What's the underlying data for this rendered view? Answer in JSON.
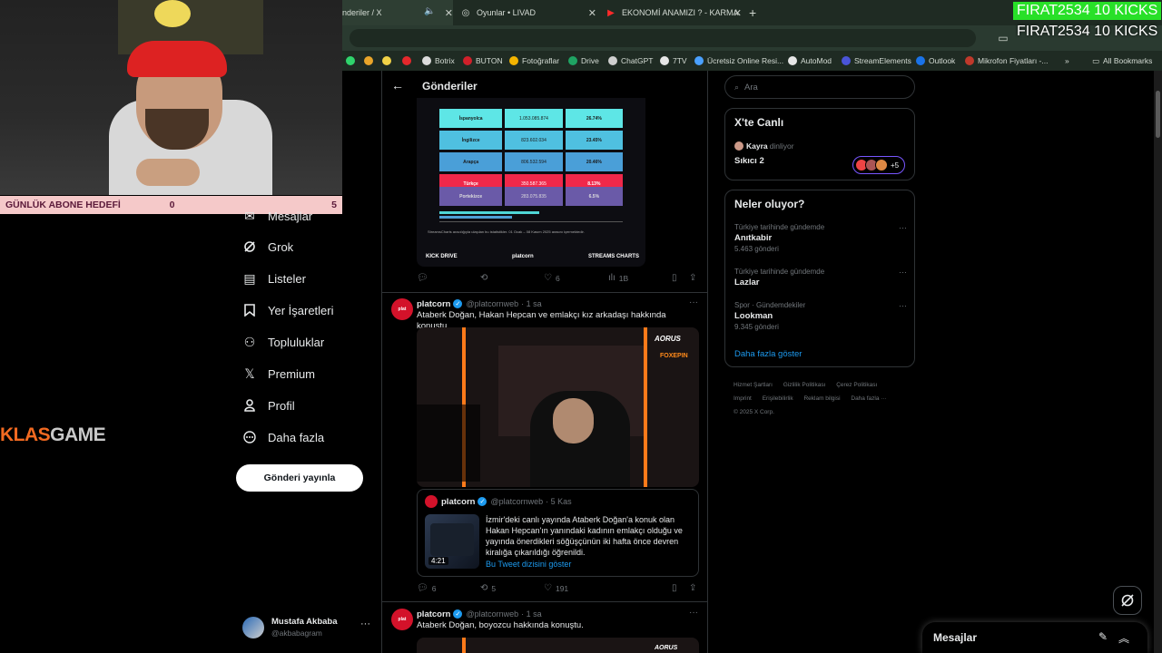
{
  "browser": {
    "tabs": [
      {
        "label": "nderiler / X",
        "icon": "x-logo-icon",
        "active": true
      },
      {
        "label": "Oyunlar • LIVAD",
        "icon": "globe-icon",
        "active": false
      },
      {
        "label": "EKONOMİ ANAMIZI ? - KARMA",
        "icon": "youtube-icon",
        "active": false
      }
    ],
    "bookmarks": [
      {
        "label": "Botrix"
      },
      {
        "label": "BUTON"
      },
      {
        "label": "Fotoğraflar"
      },
      {
        "label": "Drive"
      },
      {
        "label": "ChatGPT"
      },
      {
        "label": "7TV"
      },
      {
        "label": "Ücretsiz Online Resi..."
      },
      {
        "label": "AutoMod"
      },
      {
        "label": "StreamElements"
      },
      {
        "label": "Outlook"
      },
      {
        "label": "Mikrofon Fiyatları -..."
      },
      {
        "label": "All Bookmarks"
      }
    ]
  },
  "overlay": {
    "sub_goal_label": "GÜNLÜK ABONE HEDEFİ",
    "sub_goal_current": "0",
    "sub_goal_target": "5",
    "sponsor_part1": "KLAS",
    "sponsor_part2": "GAME",
    "kicks": "FIRAT2534  10 KICKS"
  },
  "nav": {
    "items": [
      {
        "label": "Mesajlar",
        "icon": "mail-icon"
      },
      {
        "label": "Grok",
        "icon": "grok-icon"
      },
      {
        "label": "Listeler",
        "icon": "list-icon"
      },
      {
        "label": "Yer İşaretleri",
        "icon": "bookmark-icon"
      },
      {
        "label": "Topluluklar",
        "icon": "communities-icon"
      },
      {
        "label": "Premium",
        "icon": "x-logo-icon"
      },
      {
        "label": "Profil",
        "icon": "profile-icon"
      },
      {
        "label": "Daha fazla",
        "icon": "more-circle-icon"
      }
    ],
    "post_button": "Gönderi yayınla",
    "account_name": "Mustafa Akbaba",
    "account_handle": "@akbabagram"
  },
  "main": {
    "title": "Gönderiler",
    "stats_table": [
      {
        "lang": "İspanyolca",
        "hours": "1.053.085.874",
        "share": "26.74%",
        "color": "#5ee6e6"
      },
      {
        "lang": "İngilizce",
        "hours": "823.602.034",
        "share": "23.45%",
        "color": "#4fc0e0"
      },
      {
        "lang": "Arapça",
        "hours": "806.532.594",
        "share": "20.46%",
        "color": "#4a9fd8"
      },
      {
        "lang": "Türkçe",
        "hours": "350.587.365",
        "share": "8.13%",
        "color": "#f0284a"
      },
      {
        "lang": "Portekizce",
        "hours": "283.075.835",
        "share": "6.5%",
        "color": "#6a5aa8"
      }
    ],
    "stats_footer": "StreamsCharts aracılığıyla ulaşılan bu istatistikler. 01 Ocak – 08 Kasım 2025 arasını içermektedir.",
    "stats_logo_left": "KICK DRIVE",
    "stats_logo_mid": "platcorn",
    "stats_logo_right": "STREAMS CHARTS",
    "tweet0_actions": {
      "reply": "",
      "retweet": "",
      "like": "6",
      "views": "1B"
    },
    "tweet1": {
      "name": "platcorn",
      "handle": "@platcornweb",
      "time": "· 1 sa",
      "text": "Ataberk Doğan, Hakan Hepcan ve emlakçı kız arkadaşı hakkında konuştu.",
      "video_brand1": "AORUS",
      "video_brand2": "FOXEPIN",
      "quote": {
        "name": "platcorn",
        "handle": "@platcornweb",
        "time": "· 5 Kas",
        "text": "İzmir'deki canlı yayında Ataberk Doğan'a konuk olan Hakan Hepcan'ın yanındaki kadının emlakçı olduğu ve yayında önerdikleri söğüşçünün iki hafta önce devren kiralığa çıkarıldığı öğrenildi.",
        "duration": "4:21",
        "link": "Bu Tweet dizisini göster"
      },
      "actions": {
        "reply": "6",
        "retweet": "5",
        "like": "191"
      }
    },
    "tweet2": {
      "name": "platcorn",
      "handle": "@platcornweb",
      "time": "· 1 sa",
      "text": "Ataberk Doğan, boyozcu hakkında konuştu.",
      "video_brand1": "AORUS"
    }
  },
  "sidebar": {
    "search_placeholder": "Ara",
    "live": {
      "title": "X'te Canlı",
      "host": "Kayra",
      "host_status": "dinliyor",
      "space": "Sıkıcı 2",
      "extra": "+5"
    },
    "trends_title": "Neler oluyor?",
    "trends": [
      {
        "context": "Türkiye tarihinde gündemde",
        "name": "Anıtkabir",
        "count": "5.463 gönderi"
      },
      {
        "context": "Türkiye tarihinde gündemde",
        "name": "Lazlar",
        "count": ""
      },
      {
        "context": "Spor · Gündemdekiler",
        "name": "Lookman",
        "count": "9.345 gönderi"
      }
    ],
    "show_more": "Daha fazla göster",
    "footer": [
      "Hizmet Şartları",
      "Gizlilik Politikası",
      "Çerez Politikası",
      "Imprint",
      "Erişilebilirlik",
      "Reklam bilgisi",
      "Daha fazla ···",
      "© 2025 X Corp."
    ]
  },
  "messages_drawer": {
    "title": "Mesajlar"
  }
}
